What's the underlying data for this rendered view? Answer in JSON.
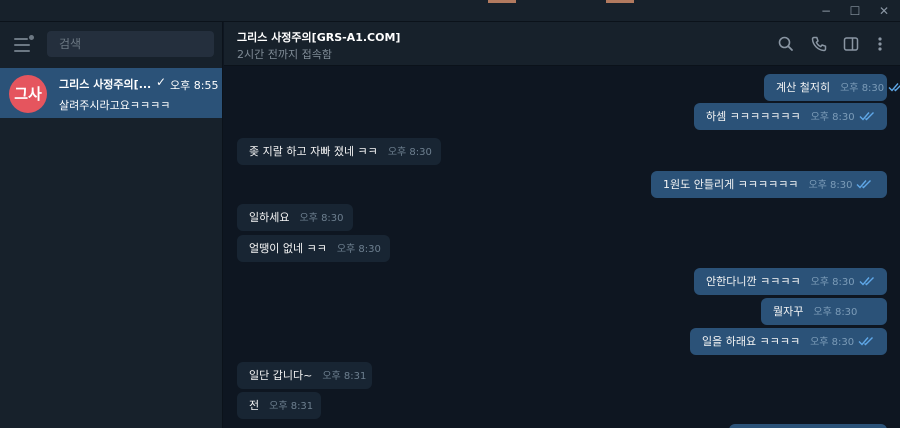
{
  "window": {
    "minimize_glyph": "−",
    "maximize_glyph": "☐",
    "close_glyph": "✕"
  },
  "sidebar": {
    "search_placeholder": "검색",
    "chats": [
      {
        "avatar_text": "그사",
        "avatar_color": "#e5555e",
        "name": "그리스 사정주의[...",
        "status_icon": "check-icon",
        "check_glyph": "✓",
        "time": "오후 8:55",
        "preview": "살려주시라고요ㅋㅋㅋㅋ",
        "selected": true
      }
    ]
  },
  "header": {
    "title": "그리스 사정주의[GRS-A1.COM]",
    "status": "2시간 전까지 접속함",
    "icons": [
      "search-icon",
      "phone-icon",
      "sidebar-toggle-icon",
      "more-vertical-icon"
    ]
  },
  "messages": [
    {
      "direction": "out",
      "text": "계산 철저히",
      "time": "오후 8:30",
      "read": true
    },
    {
      "direction": "out",
      "text": "하셈 ㅋㅋㅋㅋㅋㅋㅋ",
      "time": "오후 8:30",
      "read": true
    },
    {
      "direction": "in",
      "text": "좆 지랄 하고 자빠 졌네 ㅋㅋ",
      "time": "오후 8:30"
    },
    {
      "direction": "out",
      "text": "1원도 안틀리게 ㅋㅋㅋㅋㅋㅋ",
      "time": "오후 8:30",
      "read": true
    },
    {
      "direction": "in",
      "text": "일하세요",
      "time": "오후 8:30"
    },
    {
      "direction": "in",
      "text": "얼땡이 없네 ㅋㅋ",
      "time": "오후 8:30"
    },
    {
      "direction": "out",
      "text": "안한다니깐 ㅋㅋㅋㅋ",
      "time": "오후 8:30",
      "read": true
    },
    {
      "direction": "out",
      "text": "뭘자꾸",
      "time": "오후 8:30",
      "read": true
    },
    {
      "direction": "out",
      "text": "일을 하래요 ㅋㅋㅋㅋ",
      "time": "오후 8:30",
      "read": true
    },
    {
      "direction": "in",
      "text": "일단 갑니다~",
      "time": "오후 8:31"
    },
    {
      "direction": "in",
      "text": "전",
      "time": "오후 8:31"
    }
  ],
  "colors": {
    "app_bg": "#0e1621",
    "panel_bg": "#17212b",
    "outgoing_bubble": "#2b5278",
    "incoming_bubble": "#182533",
    "read_ticks": "#5fa8e8",
    "selected_chat": "#2b5278"
  }
}
